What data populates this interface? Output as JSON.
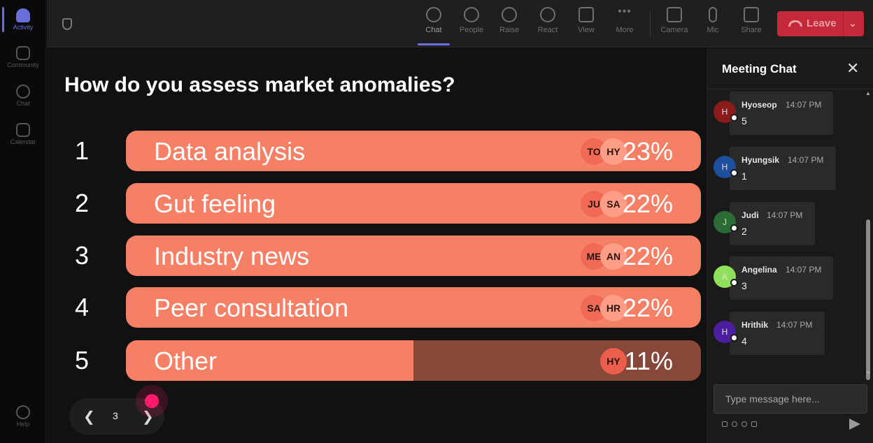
{
  "rail": {
    "items": [
      {
        "label": "Activity"
      },
      {
        "label": "Community"
      },
      {
        "label": "Chat"
      },
      {
        "label": "Calendar"
      }
    ],
    "help": "Help"
  },
  "toolbar": {
    "buttons": [
      {
        "label": "Chat",
        "icon": "chat-icon"
      },
      {
        "label": "People",
        "icon": "people-icon"
      },
      {
        "label": "Raise",
        "icon": "raise-hand-icon"
      },
      {
        "label": "React",
        "icon": "react-icon"
      },
      {
        "label": "View",
        "icon": "view-icon"
      },
      {
        "label": "More",
        "icon": "more-icon"
      },
      {
        "label": "Camera",
        "icon": "camera-icon"
      },
      {
        "label": "Mic",
        "icon": "mic-icon"
      },
      {
        "label": "Share",
        "icon": "share-icon"
      }
    ],
    "leave_label": "Leave",
    "leave_color": "#c4283a",
    "accent": "#6a6fdc"
  },
  "poll": {
    "question": "How do you assess market anomalies?",
    "options": [
      {
        "num": "1",
        "label": "Data analysis",
        "percent": "23%",
        "fill_fraction": 1.0,
        "avatars": [
          "TO",
          "HY"
        ]
      },
      {
        "num": "2",
        "label": "Gut feeling",
        "percent": "22%",
        "fill_fraction": 1.0,
        "avatars": [
          "JU",
          "SA"
        ]
      },
      {
        "num": "3",
        "label": "Industry news",
        "percent": "22%",
        "fill_fraction": 1.0,
        "avatars": [
          "ME",
          "AN"
        ]
      },
      {
        "num": "4",
        "label": "Peer consultation",
        "percent": "22%",
        "fill_fraction": 1.0,
        "avatars": [
          "SA",
          "HR"
        ]
      },
      {
        "num": "5",
        "label": "Other",
        "percent": "11%",
        "fill_fraction": 0.5,
        "avatars": [
          "HY"
        ]
      }
    ],
    "bar_color": "#f58066",
    "bar_track_color": "#87483a",
    "page": "3"
  },
  "chat": {
    "title": "Meeting Chat",
    "messages": [
      {
        "initial": "H",
        "name": "Hyoseop",
        "time": "14:07 PM",
        "text": "5",
        "color": "#8b1a1a"
      },
      {
        "initial": "H",
        "name": "Hyungsik",
        "time": "14:07 PM",
        "text": "1",
        "color": "#1d4f9c"
      },
      {
        "initial": "J",
        "name": "Judi",
        "time": "14:07 PM",
        "text": "2",
        "color": "#2a6b36"
      },
      {
        "initial": "A",
        "name": "Angelina",
        "time": "14:07 PM",
        "text": "3",
        "color": "#8fe05a"
      },
      {
        "initial": "H",
        "name": "Hrithik",
        "time": "14:07 PM",
        "text": "4",
        "color": "#4b1fa0"
      }
    ],
    "placeholder": "Type message here..."
  }
}
